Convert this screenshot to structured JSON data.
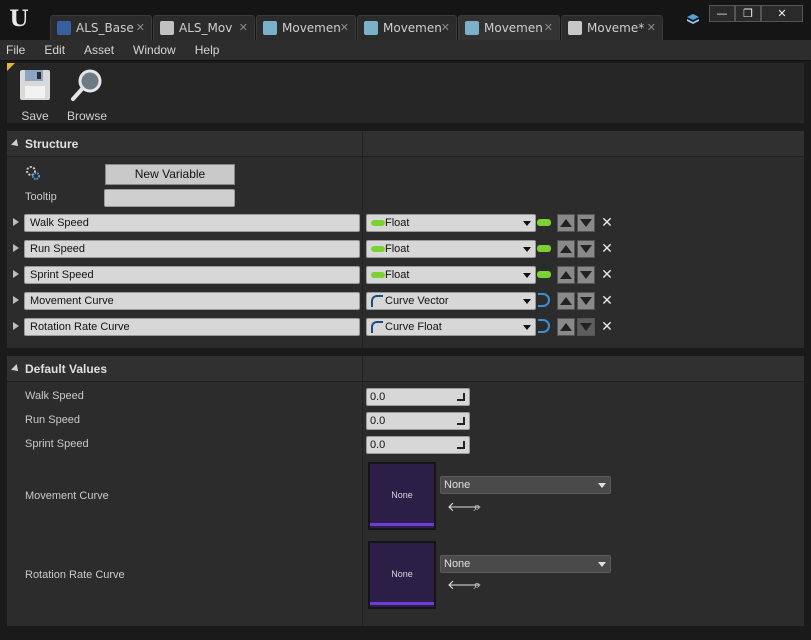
{
  "tabs": [
    {
      "label": "ALS_Base",
      "icon": "struct-icon",
      "color": "#3a5fa0"
    },
    {
      "label": "ALS_Mov",
      "icon": "blueprint-icon",
      "color": "#c0c0c0"
    },
    {
      "label": "Movemen",
      "icon": "datatable-icon",
      "color": "#7ab0c8"
    },
    {
      "label": "Movemen",
      "icon": "datatable-icon",
      "color": "#7ab0c8"
    },
    {
      "label": "Movemen",
      "icon": "datatable-icon",
      "color": "#7ab0c8"
    },
    {
      "label": "Moveme*",
      "icon": "document-icon",
      "color": "#c8c8c8"
    }
  ],
  "window": {
    "minimize": "—",
    "restore": "❐",
    "close": "✕"
  },
  "menu": [
    "File",
    "Edit",
    "Asset",
    "Window",
    "Help"
  ],
  "toolbar": {
    "save_label": "Save",
    "browse_label": "Browse"
  },
  "structure": {
    "title": "Structure",
    "new_variable_label": "New Variable",
    "tooltip_label": "Tooltip",
    "tooltip_value": "",
    "variables": [
      {
        "name": "Walk Speed",
        "type": "Float",
        "kind": "float"
      },
      {
        "name": "Run Speed",
        "type": "Float",
        "kind": "float"
      },
      {
        "name": "Sprint Speed",
        "type": "Float",
        "kind": "float"
      },
      {
        "name": "Movement Curve",
        "type": "Curve Vector",
        "kind": "curve"
      },
      {
        "name": "Rotation Rate Curve",
        "type": "Curve Float",
        "kind": "curve"
      }
    ]
  },
  "defaults": {
    "title": "Default Values",
    "walk_speed_label": "Walk Speed",
    "walk_speed_value": "0.0",
    "run_speed_label": "Run Speed",
    "run_speed_value": "0.0",
    "sprint_speed_label": "Sprint Speed",
    "sprint_speed_value": "0.0",
    "movement_curve_label": "Movement Curve",
    "movement_curve_thumb": "None",
    "movement_curve_value": "None",
    "rotation_curve_label": "Rotation Rate Curve",
    "rotation_curve_thumb": "None",
    "rotation_curve_value": "None"
  },
  "colors": {
    "accent": "#e0b53a",
    "float_pin": "#7ad232",
    "curve_thumb": "#2b1f48",
    "curve_bar": "#6f3bd6"
  }
}
